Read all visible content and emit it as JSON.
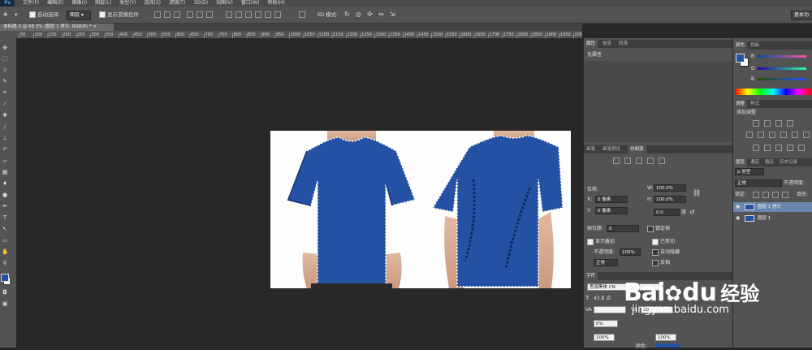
{
  "app": {
    "logo": "Ps"
  },
  "menu": [
    "文件(F)",
    "编辑(E)",
    "图像(I)",
    "图层(L)",
    "类型(Y)",
    "选择(S)",
    "滤镜(T)",
    "3D(D)",
    "视图(V)",
    "窗口(W)",
    "帮助(H)"
  ],
  "options": {
    "auto_select_label": "自动选择:",
    "auto_select_value": "图层",
    "show_transform_label": "显示变换控件",
    "mode_3d_label": "3D 模式:",
    "workspace_button": "基本功"
  },
  "document_tab": {
    "title": "未标题-3 @ 68.3% (图层 1 拷贝, RGB/8) *",
    "close": "×"
  },
  "ruler_ticks": [
    "50",
    "100",
    "150",
    "200",
    "250",
    "300",
    "350",
    "400",
    "450",
    "500",
    "550",
    "600",
    "650",
    "700",
    "750",
    "800",
    "850",
    "900",
    "950",
    "1000",
    "1050",
    "1100",
    "1150",
    "1200",
    "1250",
    "1300",
    "1350",
    "1400",
    "1450",
    "1500",
    "1550",
    "1600",
    "1650",
    "1700",
    "1750",
    "1800",
    "1850",
    "1900",
    "1950",
    "2000"
  ],
  "properties_panel": {
    "tabs": [
      "属性",
      "信息",
      "段落"
    ],
    "no_properties": "无属性"
  },
  "transform_panel": {
    "tabs": [
      "画笔",
      "画笔预设",
      "仿制源"
    ],
    "offset_label": "位移:",
    "x_label": "X:",
    "x_value": "0 像素",
    "y_label": "Y:",
    "y_value": "0 像素",
    "w_label": "W:",
    "w_value": "100.0%",
    "h_label": "H:",
    "h_value": "100.0%",
    "angle_value": "0.0",
    "angle_unit": "度",
    "frame_offset_label": "帧位移:",
    "frame_offset_value": "0",
    "lock_frame_label": "锁定帧",
    "show_overlay_label": "显示叠加",
    "opacity_label": "不透明度:",
    "opacity_value": "100%",
    "clipped_label": "已剪切",
    "auto_hide_label": "自动隐藏",
    "blend_value": "正常",
    "invert_label": "反相"
  },
  "character_panel": {
    "tab": "字符",
    "font_family": "思源黑体 CN",
    "font_size": "43.8 点",
    "tracking": "20",
    "scale_v": "0%",
    "scale_h1": "100%",
    "scale_h2": "100%",
    "color_label": "颜色:"
  },
  "color_panel": {
    "tabs": [
      "颜色",
      "色板"
    ],
    "r_label": "R",
    "g_label": "G",
    "b_label": "B",
    "foreground": "#2551a2",
    "background": "#ffffff"
  },
  "adjustments_panel": {
    "tabs": [
      "调整",
      "样式"
    ],
    "add_adjustment": "添加调整"
  },
  "layers_panel": {
    "tabs": [
      "图层",
      "通道",
      "路径",
      "历史记录"
    ],
    "filter_value": "ρ 类型",
    "blend_mode": "正常",
    "opacity_label": "不透明度:",
    "lock_label": "锁定:",
    "fill_label": "填充:",
    "layers": [
      {
        "name": "图层 1 拷贝",
        "selected": true
      },
      {
        "name": "图层 1",
        "selected": false
      }
    ]
  },
  "watermark": {
    "brand": "Bai",
    "brand2": "du",
    "product": "经验",
    "url": "jingyan.baidu.com"
  },
  "colors": {
    "shirt": "#2451a3",
    "selection_highlight": "#6b87ad"
  }
}
